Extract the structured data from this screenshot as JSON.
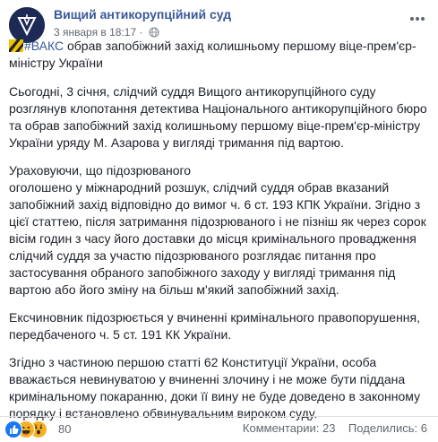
{
  "post": {
    "page_name": "Вищий антикорупційний суд",
    "date": "3 января в 18:17",
    "separator": "·",
    "headline_hashtag": "#ВАКС",
    "headline_line1": " обрав запобіжний захід колишньому першому віце-прем'єр-",
    "headline_line2": "міністру України",
    "paragraphs": [
      [
        "Сьогодні, 3 січня, слідчий суддя Вищого антикорупційного суду",
        "розглянув клопотання детектива Національного антикорупційного бюро",
        "та обрав запобіжний захід колишньому першому віце-прем'єр-міністру",
        "України уряду М. Азарова у вигляді тримання під вартою."
      ],
      [
        "Ураховуючи, що підозрюваного",
        "оголошено у міжнародний розшук, слідчий суддя обрав вказаний",
        "запобіжний захід відповідно до вимог ч. 6 ст. 193 КПК України. Згідно з",
        "цієї статтею, після затримання підозрюваного і не пізніш як через сорок",
        "вісім годин з часу його доставки до місця кримінального провадження",
        "слідчий суддя за участю підозрюваного розглядає питання про",
        "застосування обраного запобіжного заходу у вигляді тримання під",
        "вартою або його зміну на більш м'який запобіжний захід."
      ],
      [
        "Ексчиновник підозрюється у вчиненні кримінального правопорушення,",
        "передбаченого ч. 5 ст. 191 КК України."
      ],
      [
        "Згідно з частиною першою статті 62 Конституції України, особа",
        "вважається невинуватою у вчиненні злочину і не може бути піддана",
        "кримінальному покаранню, доки її вину не буде доведено в законному",
        "порядку і встановлено обвинувальним вироком суду."
      ]
    ]
  },
  "footer": {
    "reaction_count": "80",
    "comments": "Комментарии: 23",
    "shares": "Поделились: 6",
    "icons": [
      "like-icon",
      "haha-icon",
      "wow-icon"
    ]
  },
  "colors": {
    "link": "#385898",
    "text": "#1d2129",
    "meta": "#616770",
    "avatar_bg": "#1e2a56"
  }
}
